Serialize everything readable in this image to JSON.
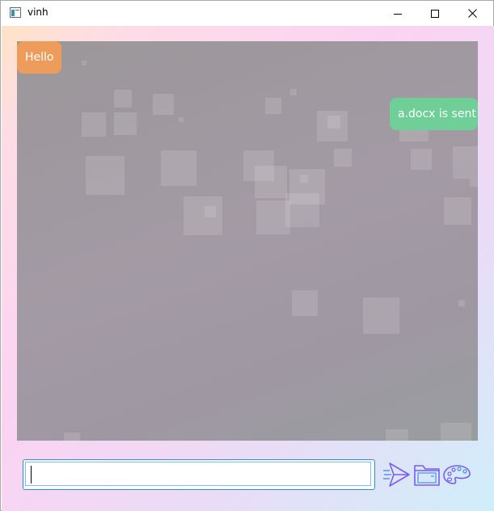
{
  "window": {
    "title": "vinh"
  },
  "chat": {
    "messages": [
      {
        "side": "left",
        "text": "Hello"
      },
      {
        "side": "right",
        "text": "a.docx is sent"
      }
    ]
  },
  "composer": {
    "value": "",
    "placeholder": ""
  },
  "icons": {
    "app": "app-icon",
    "minimize": "minimize-icon",
    "maximize": "maximize-icon",
    "close": "close-icon",
    "send": "send-icon",
    "folder": "folder-icon",
    "palette": "palette-icon"
  },
  "colors": {
    "incoming_bubble": "#ee9c5c",
    "outgoing_bubble": "#6fcf97",
    "icon_stroke": "#7b5cf0",
    "input_border": "#2c8fd6"
  }
}
